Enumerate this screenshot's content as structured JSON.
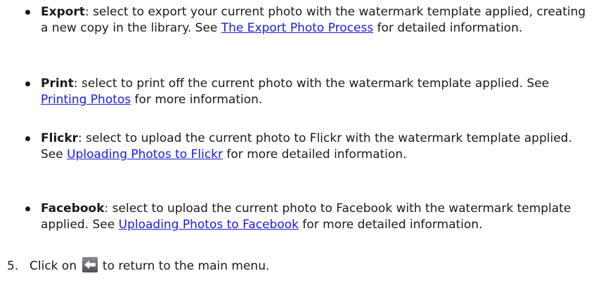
{
  "options": [
    {
      "term": "Export",
      "text1": ": select to export your current photo with the watermark template applied, creating a new copy in the library. See ",
      "link": "The Export Photo Process",
      "text2": " for detailed information."
    },
    {
      "term": "Print",
      "text1": ": select to print off the current photo with the watermark template applied. See ",
      "link": "Printing Photos",
      "text2": " for more information."
    },
    {
      "term": "Flickr",
      "text1": ": select to upload the current photo to Flickr with the watermark template applied. See ",
      "link": "Uploading Photos to Flickr",
      "text2": " for more detailed information."
    },
    {
      "term": "Facebook",
      "text1": ": select to upload the current photo to Facebook with the watermark template applied. See ",
      "link": "Uploading Photos to Facebook",
      "text2": " for more detailed information."
    }
  ],
  "step": {
    "number": "5.",
    "before_icon": "Click on ",
    "icon": "back-arrow-icon",
    "after_icon": " to return to the main menu."
  },
  "colors": {
    "link": "#1a1adb",
    "text": "#1a1a1a"
  }
}
